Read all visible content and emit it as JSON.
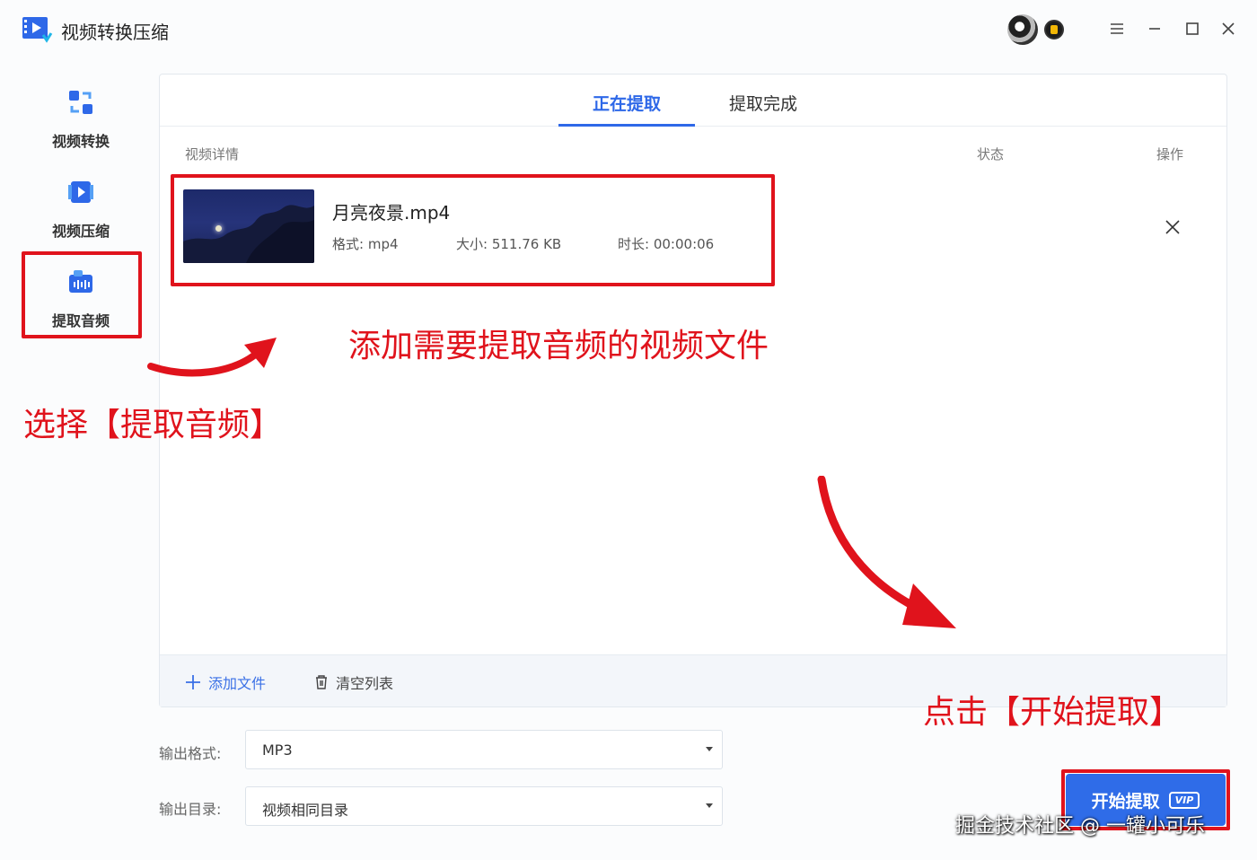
{
  "app": {
    "title": "视频转换压缩"
  },
  "sidebar": {
    "items": [
      {
        "label": "视频转换"
      },
      {
        "label": "视频压缩"
      },
      {
        "label": "提取音频"
      }
    ]
  },
  "tabs": [
    {
      "label": "正在提取"
    },
    {
      "label": "提取完成"
    }
  ],
  "list": {
    "headers": {
      "details": "视频详情",
      "status": "状态",
      "action": "操作"
    },
    "files": [
      {
        "name": "月亮夜景.mp4",
        "format_label": "格式:",
        "format": "mp4",
        "size_label": "大小:",
        "size": "511.76 KB",
        "duration_label": "时长:",
        "duration": "00:00:06"
      }
    ]
  },
  "footer": {
    "add_label": "添加文件",
    "clear_label": "清空列表"
  },
  "output": {
    "format_label": "输出格式:",
    "format_value": "MP3",
    "dir_label": "输出目录:",
    "dir_value": "视频相同目录"
  },
  "start_button": {
    "label": "开始提取",
    "vip": "VIP"
  },
  "annotations": {
    "add_video": "添加需要提取音频的视频文件",
    "select_extract": "选择【提取音频】",
    "click_start": "点击【开始提取】"
  },
  "watermark": "掘金技术社区 @ 一罐小可乐",
  "colors": {
    "accent": "#2e68e8",
    "annotation_red": "#e0131c"
  }
}
